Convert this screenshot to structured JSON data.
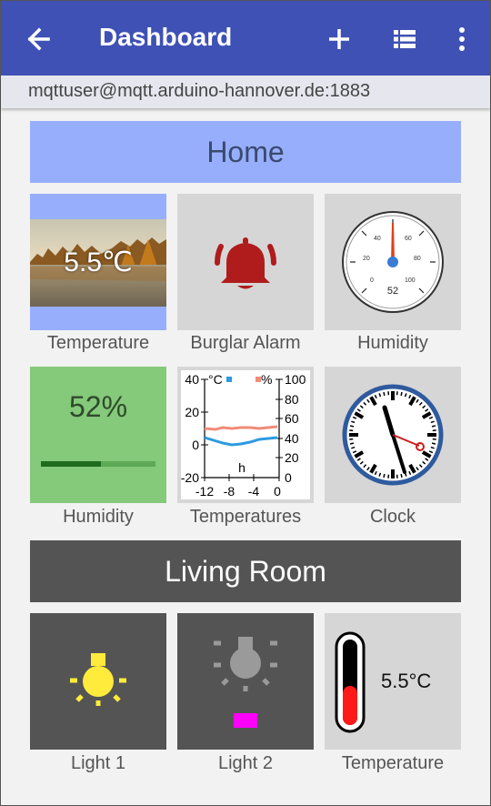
{
  "appbar": {
    "title": "Dashboard",
    "back_icon": "arrow-back-icon",
    "add_icon": "plus-icon",
    "list_icon": "list-icon",
    "more_icon": "more-vert-icon",
    "color": "#3f51b5"
  },
  "connection": "mqttuser@mqtt.arduino-hannover.de:1883",
  "groups": [
    {
      "title": "Home",
      "color": "#97aefc",
      "tiles": [
        {
          "label": "Temperature",
          "value": "5.5℃",
          "kind": "image-text"
        },
        {
          "label": "Burglar Alarm",
          "icon": "bell-alarm-icon",
          "icon_color": "#b01c1c"
        },
        {
          "label": "Humidity",
          "gauge_value": "52",
          "gauge_ticks": [
            "0",
            "20",
            "40",
            "60",
            "80",
            "100"
          ]
        },
        {
          "label": "Humidity",
          "value": "52%",
          "progress": 0.52,
          "color": "#85c97a"
        },
        {
          "label": "Temperatures",
          "unit_left": "°C",
          "unit_right": "%",
          "left_ticks": [
            "40",
            "20",
            "0",
            "-20"
          ],
          "right_ticks": [
            "100",
            "80",
            "60",
            "40",
            "20",
            "0"
          ],
          "x_ticks": [
            "-12",
            "-8",
            "-4",
            "0"
          ],
          "x_unit": "h"
        },
        {
          "label": "Clock",
          "time": "hands-analog-clock"
        }
      ]
    },
    {
      "title": "Living Room",
      "color": "#545454",
      "tiles": [
        {
          "label": "Light 1",
          "icon": "bulb-on-icon",
          "icon_color": "#ffeb3b"
        },
        {
          "label": "Light 2",
          "icon": "bulb-off-icon",
          "indicator_color": "#ff00ff"
        },
        {
          "label": "Temperature",
          "value": "5.5°C",
          "icon": "thermometer-icon"
        }
      ]
    }
  ]
}
